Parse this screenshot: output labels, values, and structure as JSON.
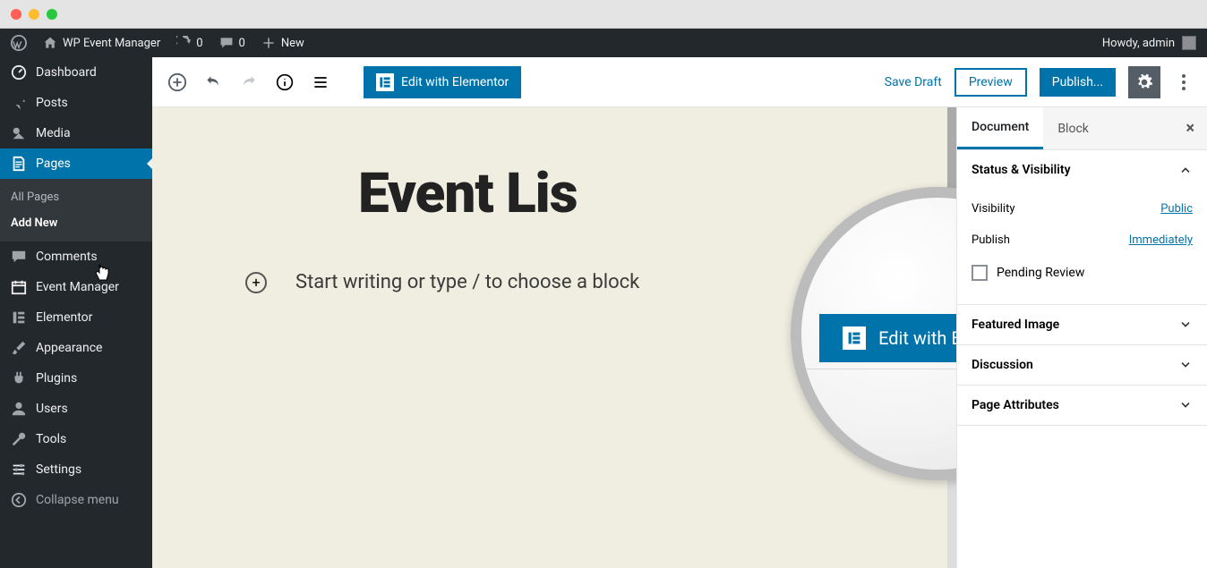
{
  "adminbar": {
    "site_title": "WP Event Manager",
    "updates": "0",
    "comments": "0",
    "new_label": "New",
    "howdy": "Howdy, admin"
  },
  "sidebar": {
    "dashboard": "Dashboard",
    "posts": "Posts",
    "media": "Media",
    "pages": "Pages",
    "pages_sub_all": "All Pages",
    "pages_sub_add": "Add New",
    "comments": "Comments",
    "event_manager": "Event Manager",
    "elementor": "Elementor",
    "appearance": "Appearance",
    "plugins": "Plugins",
    "users": "Users",
    "tools": "Tools",
    "settings": "Settings",
    "collapse": "Collapse menu"
  },
  "editor": {
    "elementor_btn": "Edit with Elementor",
    "save_draft": "Save Draft",
    "preview": "Preview",
    "publish": "Publish...",
    "page_title": "Event Lis",
    "block_prompt": "Start writing or type / to choose a block",
    "magnifier_btn": "Edit with Elementor"
  },
  "docpanel": {
    "tab_document": "Document",
    "tab_block": "Block",
    "status_header": "Status & Visibility",
    "visibility_label": "Visibility",
    "visibility_value": "Public",
    "publish_label": "Publish",
    "publish_value": "Immediately",
    "pending_review": "Pending Review",
    "featured_image": "Featured Image",
    "discussion": "Discussion",
    "page_attributes": "Page Attributes"
  }
}
